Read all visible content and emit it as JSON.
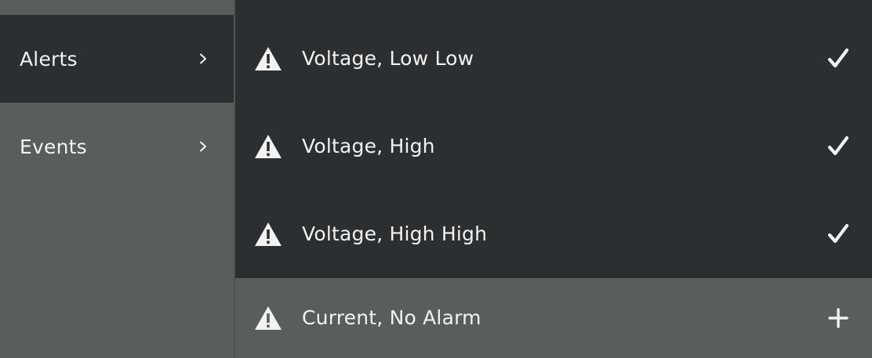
{
  "sidebar": {
    "items": [
      {
        "label": "Alerts",
        "selected": true,
        "icon": "chevron-right-icon"
      },
      {
        "label": "Events",
        "selected": false,
        "icon": "chevron-right-icon"
      }
    ]
  },
  "alerts": {
    "items": [
      {
        "label": "Voltage, Low Low",
        "icon": "warning-icon",
        "state": "enabled",
        "action_icon": "check-icon"
      },
      {
        "label": "Voltage, High",
        "icon": "warning-icon",
        "state": "enabled",
        "action_icon": "check-icon"
      },
      {
        "label": "Voltage, High High",
        "icon": "warning-icon",
        "state": "enabled",
        "action_icon": "check-icon"
      },
      {
        "label": "Current, No Alarm",
        "icon": "warning-icon",
        "state": "disabled",
        "action_icon": "plus-icon"
      }
    ]
  },
  "colors": {
    "panel_light": "#585d5d",
    "panel_dark": "#2c2f31",
    "text": "#f2f2f2"
  }
}
